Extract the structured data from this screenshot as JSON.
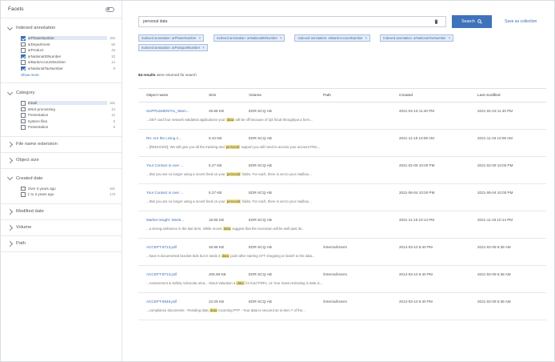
{
  "facets": {
    "title": "Facets",
    "indexed_annotation": {
      "title": "Indexed annotation",
      "options": [
        {
          "label": "arPhaseNumber",
          "count": "164",
          "checked": true,
          "selected": true
        },
        {
          "label": "arDepartment",
          "count": "82",
          "checked": false,
          "selected": false
        },
        {
          "label": "arProduct",
          "count": "43",
          "checked": false,
          "selected": false
        },
        {
          "label": "arNationalIDNumber",
          "count": "22",
          "checked": true,
          "selected": false
        },
        {
          "label": "arBankAccountNumber",
          "count": "14",
          "checked": false,
          "selected": false
        },
        {
          "label": "arNationalTaxNumber",
          "count": "9",
          "checked": true,
          "selected": false
        }
      ],
      "show_more": "Show more"
    },
    "category": {
      "title": "Category",
      "options": [
        {
          "label": "Email",
          "count": "161",
          "checked": false,
          "selected": true
        },
        {
          "label": "Word processing",
          "count": "14",
          "checked": false,
          "selected": false
        },
        {
          "label": "Presentation",
          "count": "12",
          "checked": false,
          "selected": false
        },
        {
          "label": "System files",
          "count": "9",
          "checked": false,
          "selected": false
        },
        {
          "label": "Presentation",
          "count": "5",
          "checked": false,
          "selected": false
        }
      ]
    },
    "file_name_extension": {
      "title": "File name extension"
    },
    "object_size": {
      "title": "Object size"
    },
    "created_date": {
      "title": "Created date",
      "options": [
        {
          "label": "Over 3 years ago",
          "count": "161",
          "checked": false,
          "selected": false
        },
        {
          "label": "1 to 3 years ago",
          "count": "173",
          "checked": false,
          "selected": false
        }
      ]
    },
    "modified_date": {
      "title": "Modified date"
    },
    "volume": {
      "title": "Volume"
    },
    "path": {
      "title": "Path"
    }
  },
  "search": {
    "value": "personal data",
    "button_label": "Search",
    "save_label": "Save as collection"
  },
  "chips": [
    "Indexed annotation: arPhaseNumber",
    "Indexed annotation: arNationalIDNumber",
    "Indexed annotation: arBankAccountNumber",
    "Indexed annotation: arNationalTaxNumber",
    "Indexed annotation: arPassportNumber"
  ],
  "results": {
    "count": "84 results",
    "count_suffix": "were returned for search",
    "columns": [
      "Object name",
      "Size",
      "Volume",
      "Path",
      "Created",
      "Last modified"
    ],
    "rows": [
      {
        "name": "SUPPLEMENTAL_Warn...",
        "size": "29.86 KB",
        "volume": "EDR-SCQ-AB",
        "path": "",
        "created": "2021-02-19 11:40 PM",
        "modified": "2021-02-19 11:40 PM",
        "pre": "...GET card four network validated applications your",
        "hl": "data",
        "post": "will be off because of Q3 fiscal throughput a form..."
      },
      {
        "name": "Re: Are the Living 1...",
        "size": "6.43 KB",
        "volume": "EDR-SCQ-AB",
        "path": "",
        "created": "2021-11-19 10:09 AM",
        "modified": "2021-11-19 10:09 AM",
        "pre": "...[REDUCED]: We will give you all the tracking and",
        "hl": "personal",
        "post": "support you will need to access your account PDs..."
      },
      {
        "name": "Your Contact is over ...",
        "size": "5.27 KB",
        "volume": "EDR-SCQ-AB",
        "path": "",
        "created": "2021-02-09 10:00 PM",
        "modified": "2021-02-09 10:00 PM",
        "pre": "...that you are no longer using a recent feed on your",
        "hl": "personal",
        "post": "folder. For each, there is set to your mailbox..."
      },
      {
        "name": "Your Contact is over ...",
        "size": "5.27 KB",
        "volume": "EDR-SCQ-AB",
        "path": "",
        "created": "2021-06-04 10:00 PM",
        "modified": "2021-06-04 10:00 PM",
        "pre": "...that you are no longer using a recent feed on your",
        "hl": "personal",
        "post": "folder. For each, there is set to your mailbox..."
      },
      {
        "name": "Market Insight: Week...",
        "size": "18.96 KB",
        "volume": "EDR-SCQ-AB",
        "path": "",
        "created": "2021-11-19 10:14 PM",
        "modified": "2021-11-19 10:14 PM",
        "pre": "...a strong ambience in the last term. While recent",
        "hl": "data",
        "post": "suggest that the recession will be well past its..."
      },
      {
        "name": "ACCEPT-8713.pdf",
        "size": "48.98 KB",
        "volume": "EDR-SCQ-AB",
        "path": "/Internal/Users",
        "created": "2014-03-10 6:40 PM",
        "modified": "2021-02-09 5:38 AM",
        "pre": "...have 5 documented bracket bids but in totals 3",
        "hl": "data",
        "post": "point after starting CFT shopping on batch to the data..."
      },
      {
        "name": "ACCEPT-8713.pdf",
        "size": "205.98 KB",
        "volume": "EDR-SCQ-AB",
        "path": "/Internal/Users",
        "created": "2014-03-10 6:40 PM",
        "modified": "2021-02-09 5:38 AM",
        "pre": "...Assessment & Safety Advocate area... About Valuation a",
        "hl": "data",
        "post": "for fund PDFs, 14 Your mass-reviewing is data is..."
      },
      {
        "name": "ACCEPT-6946.pdf",
        "size": "22.09 KB",
        "volume": "EDR-SCQ-AB",
        "path": "/Internal/Users",
        "created": "2014-03-10 6:40 PM",
        "modified": "2021-02-09 5:38 AM",
        "pre": "...compliance documents - Residing data",
        "hl": "data",
        "post": "incoming PTP - Your data is secured as to item 7 of the..."
      }
    ]
  },
  "colors": {
    "accent": "#3f72bb",
    "link": "#3b6fb6",
    "chip_bg": "#e5edf8",
    "highlight": "#f3e48a"
  }
}
